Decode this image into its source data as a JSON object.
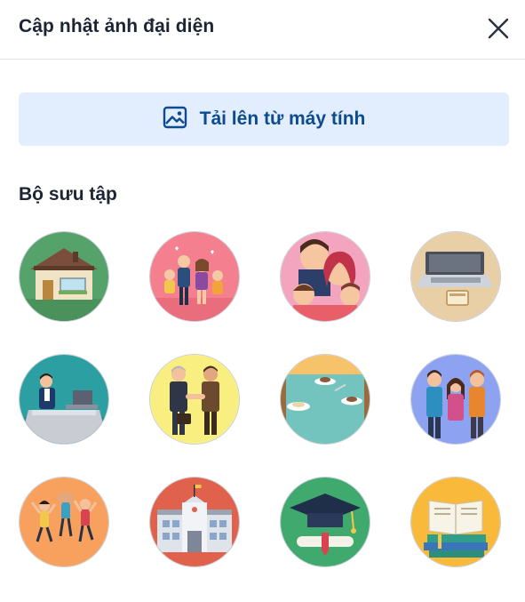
{
  "dialog": {
    "title": "Cập nhật ảnh đại diện",
    "close_icon": "close-icon"
  },
  "upload": {
    "label": "Tải lên từ máy tính",
    "icon": "image-icon"
  },
  "collection": {
    "title": "Bộ sưu tập",
    "avatars": [
      "house",
      "family-dancing",
      "family-portrait",
      "laptop-desk",
      "office-worker",
      "business-handshake",
      "cafe-table",
      "friends-group",
      "jumping-kids",
      "school-building",
      "graduation-cap",
      "books"
    ]
  },
  "colors": {
    "accent": "#0d4b8e",
    "upload_bg": "#e2eefd",
    "divider": "#dfe3ea"
  }
}
